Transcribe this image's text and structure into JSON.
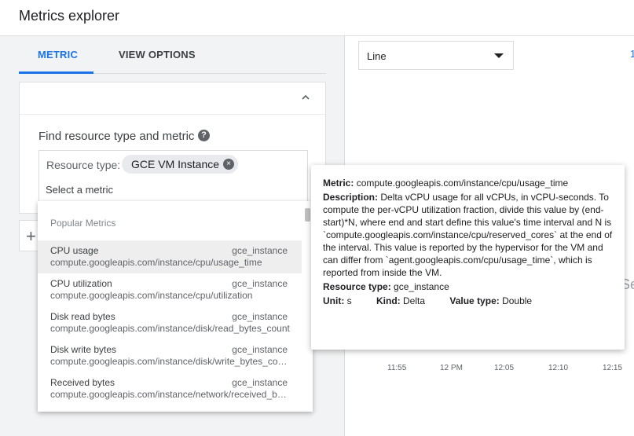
{
  "header": {
    "title": "Metrics explorer"
  },
  "tabs": {
    "metric": "METRIC",
    "view_options": "VIEW OPTIONS"
  },
  "finder": {
    "label": "Find resource type and metric",
    "help_icon": "?",
    "resource_type_label": "Resource type:",
    "resource_type_chip": "GCE VM Instance",
    "chip_remove": "×",
    "metric_placeholder": "Select a metric"
  },
  "add_button": "+",
  "dropdown": {
    "header": "Popular Metrics",
    "items": [
      {
        "name": "CPU usage",
        "resource": "gce_instance",
        "path": "compute.googleapis.com/instance/cpu/usage_time"
      },
      {
        "name": "CPU utilization",
        "resource": "gce_instance",
        "path": "compute.googleapis.com/instance/cpu/utilization"
      },
      {
        "name": "Disk read bytes",
        "resource": "gce_instance",
        "path": "compute.googleapis.com/instance/disk/read_bytes_count"
      },
      {
        "name": "Disk write bytes",
        "resource": "gce_instance",
        "path": "compute.googleapis.com/instance/disk/write_bytes_count"
      },
      {
        "name": "Received bytes",
        "resource": "gce_instance",
        "path": "compute.googleapis.com/instance/network/received_bytes_count"
      }
    ]
  },
  "chart_controls": {
    "chart_type": "Line",
    "edge_text": "1",
    "edge_text_2": "Se"
  },
  "x_ticks": [
    "11:55",
    "12 PM",
    "12:05",
    "12:10",
    "12:15"
  ],
  "tooltip": {
    "metric_label": "Metric:",
    "metric": "compute.googleapis.com/instance/cpu/usage_time",
    "description_label": "Description:",
    "description": "Delta vCPU usage for all vCPUs, in vCPU-seconds. To compute the per-vCPU utilization fraction, divide this value by (end-start)*N, where end and start define this value's time interval and N is `compute.googleapis.com/instance/cpu/reserved_cores` at the end of the interval. This value is reported by the hypervisor for the VM and can differ from `agent.googleapis.com/cpu/usage_time`, which is reported from inside the VM.",
    "resource_type_label": "Resource type:",
    "resource_type": "gce_instance",
    "unit_label": "Unit:",
    "unit": "s",
    "kind_label": "Kind:",
    "kind": "Delta",
    "value_type_label": "Value type:",
    "value_type": "Double"
  }
}
